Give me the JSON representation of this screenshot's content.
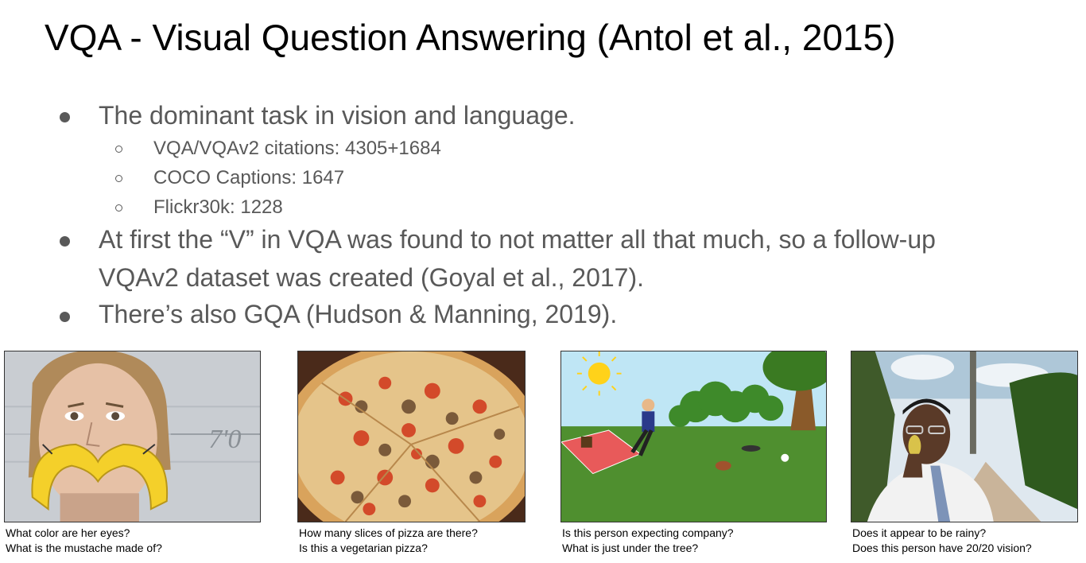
{
  "title": "VQA - Visual Question Answering (Antol et al., 2015)",
  "bullets": [
    "The dominant task in vision and language.",
    "At first the “V” in VQA was found to not matter all that much, so a follow-up",
    "VQAv2 dataset was created (Goyal et al., 2017).",
    "There’s also GQA (Hudson & Manning, 2019)."
  ],
  "subbullets": [
    "VQA/VQAv2 citations: 4305+1684",
    "COCO Captions: 1647",
    "Flickr30k: 1228"
  ],
  "examples": [
    {
      "questions": [
        "What color are her eyes?",
        "What is the mustache made of?"
      ],
      "board_text": "7'0"
    },
    {
      "questions": [
        "How many slices of pizza are there?",
        "Is this a vegetarian pizza?"
      ]
    },
    {
      "questions": [
        "Is this person expecting company?",
        "What is just under the tree?"
      ]
    },
    {
      "questions": [
        "Does it appear to be rainy?",
        "Does this person have 20/20 vision?"
      ]
    }
  ]
}
